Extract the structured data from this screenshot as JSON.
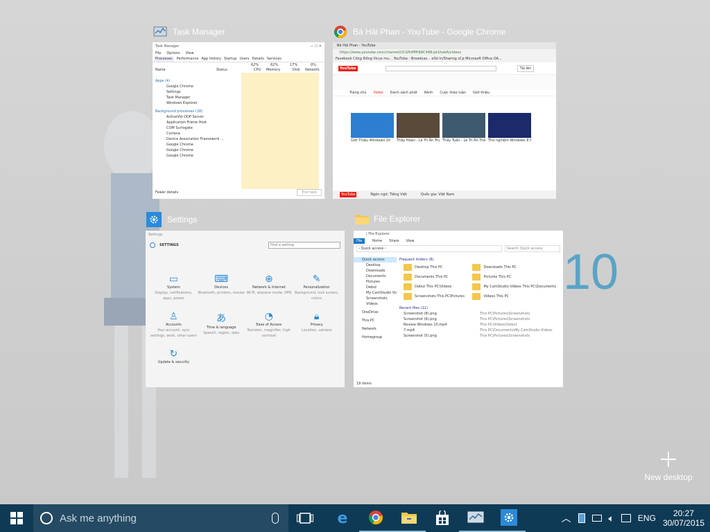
{
  "desktop": {
    "wallpaper_text": "10"
  },
  "new_desktop_label": "New desktop",
  "windows": {
    "taskmanager": {
      "title": "Task Manager",
      "window_controls": "—  ☐  ✕",
      "menu": [
        "File",
        "Options",
        "View"
      ],
      "tabs": [
        "Processes",
        "Performance",
        "App history",
        "Startup",
        "Users",
        "Details",
        "Services"
      ],
      "usage": {
        "cpu": "62%",
        "memory": "62%",
        "disk": "17%",
        "network": "0%"
      },
      "cols": [
        "Name",
        "Status",
        "CPU",
        "Memory",
        "Disk",
        "Network"
      ],
      "groups": [
        "Apps (4)",
        "Background processes (28)"
      ],
      "apps": [
        "Google Chrome",
        "Settings",
        "Task Manager",
        "Windows Explorer"
      ],
      "bg": [
        "ActiveVid OOP Server",
        "Application Frame Host",
        "COM Surrogate",
        "Cortana",
        "Device Association Framework ...",
        "Google Chrome",
        "Google Chrome",
        "Google Chrome"
      ],
      "fewer_details": "Fewer details",
      "end_task": "End task"
    },
    "chrome": {
      "title": "Bá Hải Phan - YouTube - Google Chrome",
      "tab": "Bá Hải Phan - YouTube",
      "url": "https://www.youtube.com/channel/UCGPsPMHjNC44B-pk1hekA/videos",
      "bookmarks": "Facebook   Công Đồng Vicus mu...   YouTube - Broadcas...   eSờ In/Sharing sCp   Microsoft Office OA...",
      "youtube": "YouTube",
      "upload": "Tải lên",
      "channel_tabs": [
        "Trang chủ",
        "Video",
        "Danh sách phát",
        "Kênh",
        "Cuộc thảo luận",
        "Giới thiệu"
      ],
      "videos": [
        "Giới Thiệu Windows 10",
        "Thầy Hoan - Lê Trí Ân Trường",
        "Thầy Tuấn - Lê Tri Ân Trường",
        "Thử nghiệm Windows 8 RTM"
      ],
      "footer": [
        "Ngôn ngữ: Tiếng Việt",
        "Quốc gia: Việt Nam"
      ]
    },
    "settings": {
      "title": "Settings",
      "heading": "SETTINGS",
      "search_placeholder": "Find a setting",
      "tiles": [
        {
          "glyph": "▭",
          "name": "System",
          "desc": "Display, notifications, apps, power"
        },
        {
          "glyph": "⌨",
          "name": "Devices",
          "desc": "Bluetooth, printers, mouse"
        },
        {
          "glyph": "⊕",
          "name": "Network & Internet",
          "desc": "Wi-Fi, airplane mode, VPN"
        },
        {
          "glyph": "✎",
          "name": "Personalization",
          "desc": "Background, lock screen, colors"
        },
        {
          "glyph": "♙",
          "name": "Accounts",
          "desc": "Your account, sync settings, work, other users"
        },
        {
          "glyph": "あ",
          "name": "Time & language",
          "desc": "Speech, region, date"
        },
        {
          "glyph": "◔",
          "name": "Ease of Access",
          "desc": "Narrator, magnifier, high contrast"
        },
        {
          "glyph": "🔒︎",
          "name": "Privacy",
          "desc": "Location, camera"
        },
        {
          "glyph": "↻",
          "name": "Update & security"
        }
      ]
    },
    "explorer": {
      "title": "File Explorer",
      "titlebar": "| File Explorer",
      "ribbon": [
        "File",
        "Home",
        "Share",
        "View"
      ],
      "address": "› Quick access ›",
      "search_placeholder": "Search Quick access",
      "nav": [
        "Quick access",
        "Desktop",
        "Downloads",
        "Documents",
        "Pictures",
        "Debut",
        "My CamStudio Vide",
        "Screenshots",
        "Videos",
        "OneDrive",
        "This PC",
        "Network",
        "Homegroup"
      ],
      "frequent_header": "Frequent folders (8)",
      "folders": [
        "Desktop This PC",
        "Downloads This PC",
        "Documents This PC",
        "Pictures This PC",
        "Debut This PC\\Videos",
        "My CamStudio Videos This PC\\Documents",
        "Screenshots This PC\\Pictures",
        "Videos This PC"
      ],
      "recent_header": "Recent files (11)",
      "recent": [
        {
          "name": "Screenshot (8).png",
          "path": "This PC\\Pictures\\Screenshots"
        },
        {
          "name": "Screenshot (6).png",
          "path": "This PC\\Pictures\\Screenshots"
        },
        {
          "name": "Review Windows 10.mp4",
          "path": "This PC\\Videos\\Debut"
        },
        {
          "name": "7.mp4",
          "path": "This PC\\Documents\\My CamStudio Videos"
        },
        {
          "name": "Screenshot (5).png",
          "path": "This PC\\Pictures\\Screenshots"
        }
      ],
      "status": "19 items"
    }
  },
  "taskbar": {
    "search_placeholder": "Ask me anything",
    "language": "ENG",
    "time": "20:27",
    "date": "30/07/2015"
  }
}
